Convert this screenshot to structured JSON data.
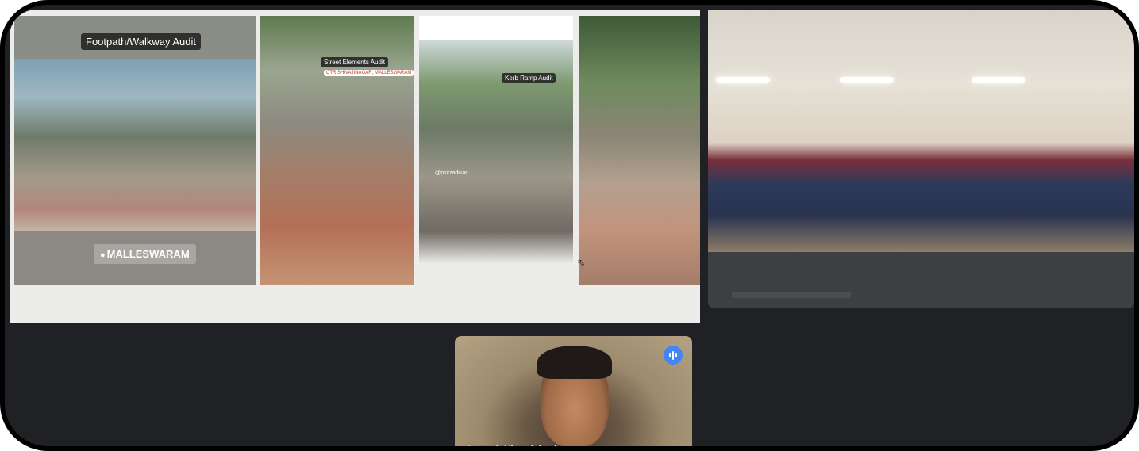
{
  "presentation": {
    "slide1_title": "Footpath/Walkway Audit",
    "slide1_location": "MALLESWARAM",
    "slide2_title": "Street Elements Audit",
    "slide2_subtitle": "CTR SHIVAJINAGAR, MALLESWARAM",
    "slide3_title": "Kerb Ramp Audit",
    "slide3_watermark": "@psitzadikar"
  },
  "participant": {
    "name": "Prateek Khandelwal",
    "speaking_icon": "audio-wave-icon",
    "accent_color": "#4285f4"
  }
}
